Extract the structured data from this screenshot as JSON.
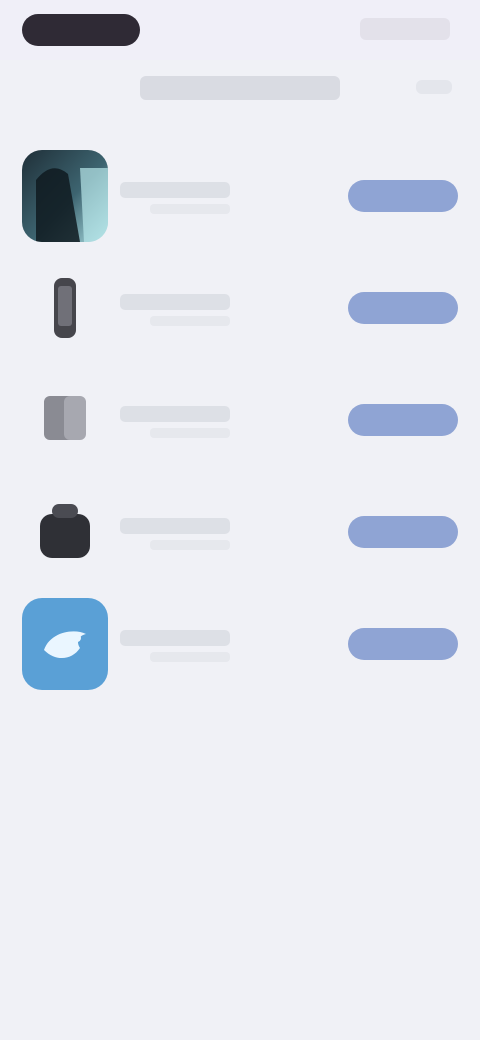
{
  "status_bar": {
    "icons": [
      "time-pill",
      "status-icons"
    ]
  },
  "header": {
    "title_icon": "title-placeholder",
    "action_icon": "header-action"
  },
  "apps": [
    {
      "icon": "portrait-app-icon",
      "action": "get-button"
    },
    {
      "icon": "phone-app-icon",
      "action": "get-button"
    },
    {
      "icon": "cube-app-icon",
      "action": "get-button"
    },
    {
      "icon": "bag-app-icon",
      "action": "get-button"
    },
    {
      "icon": "bird-app-icon",
      "action": "get-button",
      "color": "#5aa0d6"
    }
  ],
  "colors": {
    "background": "#f0f1f6",
    "status_bar": "#f0eff8",
    "button": "#8fa4d4",
    "placeholder": "#dde0e6"
  }
}
